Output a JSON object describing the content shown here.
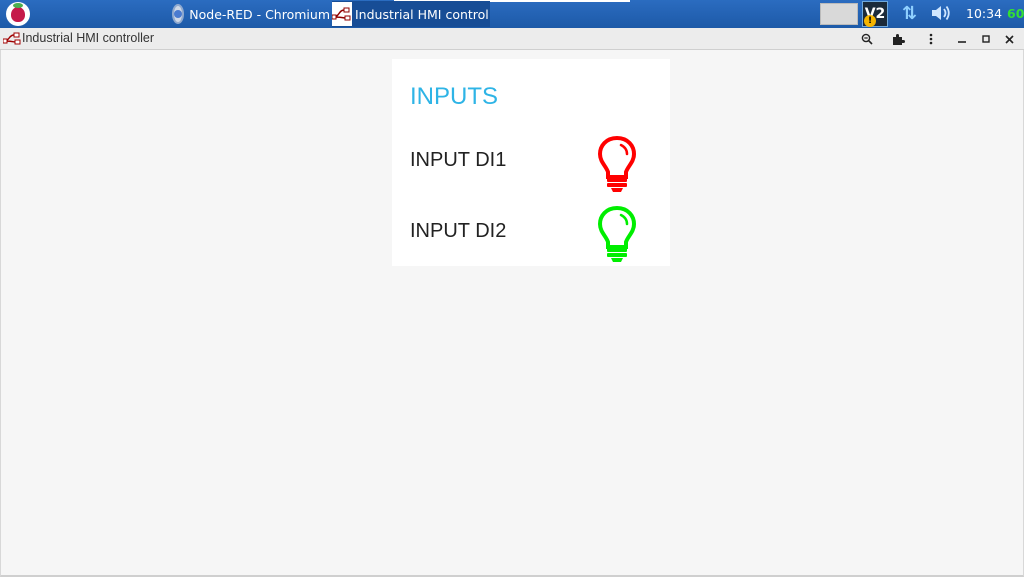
{
  "taskbar": {
    "tasks": [
      {
        "label": "Node-RED - Chromium",
        "icon": "chromium-icon"
      },
      {
        "label": "Industrial HMI control...",
        "icon": "node-red-icon",
        "active": true
      }
    ],
    "vnc_label": "V2",
    "clock": "10:34",
    "cpu": "60"
  },
  "window": {
    "title": "Industrial HMI controller",
    "controls": [
      "zoom-icon",
      "extensions-icon",
      "menu-icon",
      "minimize-icon",
      "maximize-icon",
      "close-icon"
    ]
  },
  "card": {
    "title": "INPUTS",
    "inputs": [
      {
        "label": "INPUT DI1",
        "state_color": "#ff0000"
      },
      {
        "label": "INPUT DI2",
        "state_color": "#00ee00"
      }
    ]
  },
  "colors": {
    "taskbar": "#1d5aa8",
    "accent": "#2eb4e6",
    "off": "#ff0000",
    "on": "#00ee00"
  }
}
